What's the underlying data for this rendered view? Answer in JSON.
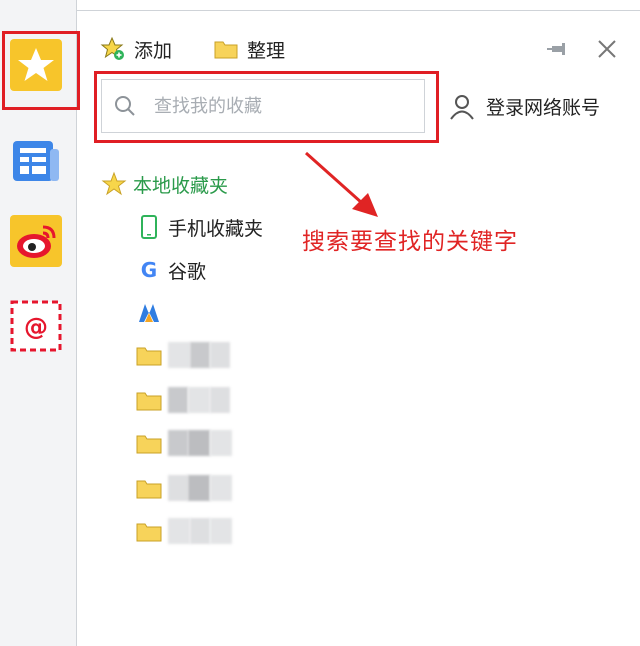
{
  "toolbar": {
    "add_label": "添加",
    "manage_label": "整理"
  },
  "search": {
    "placeholder": "查找我的收藏"
  },
  "account": {
    "login_label": "登录网络账号"
  },
  "favorites": {
    "root_label": "本地收藏夹",
    "items": [
      {
        "label": "手机收藏夹",
        "icon": "phone-icon"
      },
      {
        "label": "谷歌",
        "icon": "google-icon"
      },
      {
        "label": "",
        "icon": "app-logo-icon"
      },
      {
        "label": "",
        "icon": "folder-icon"
      },
      {
        "label": "",
        "icon": "folder-icon"
      },
      {
        "label": "",
        "icon": "folder-icon"
      },
      {
        "label": "",
        "icon": "folder-icon"
      },
      {
        "label": "",
        "icon": "folder-icon"
      }
    ]
  },
  "annotation": {
    "text": "搜索要查找的关键字",
    "color": "#e02424"
  },
  "colors": {
    "highlight": "#e01e24",
    "accent_yellow": "#f7c52b",
    "root_green": "#2a9a4a"
  }
}
